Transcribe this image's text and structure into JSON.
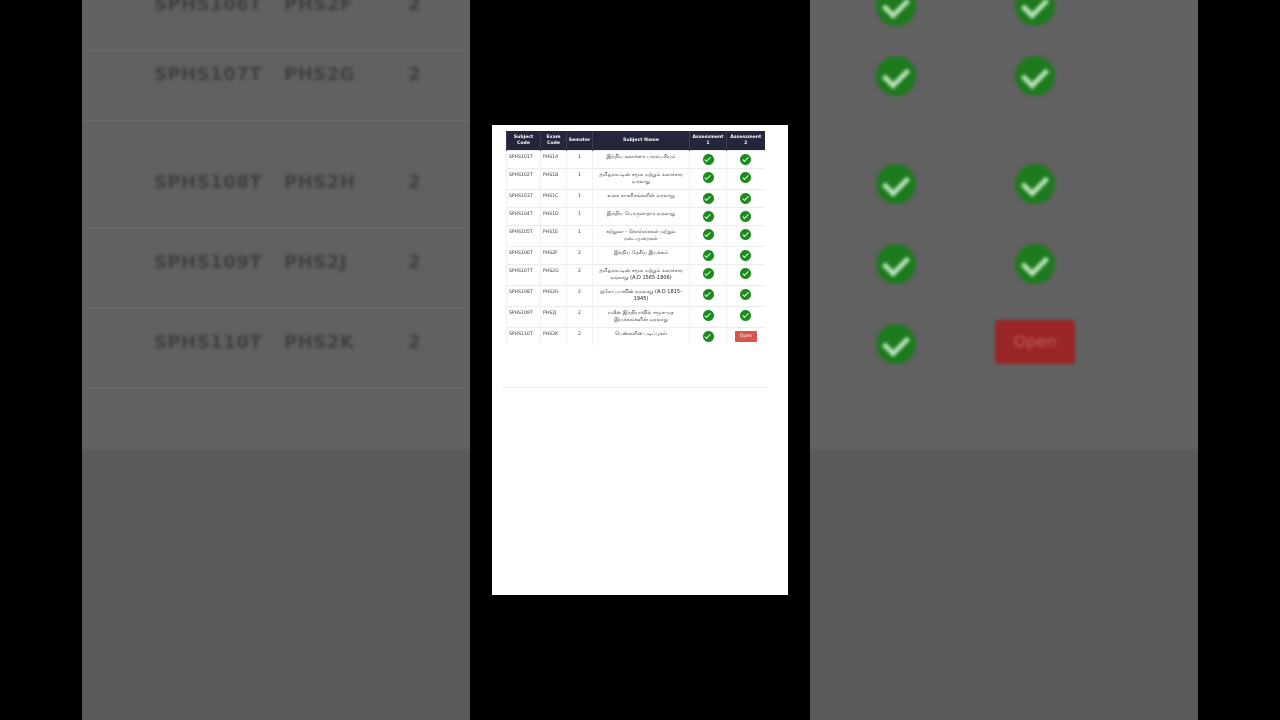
{
  "table": {
    "headers": {
      "subject_code": "Subject Code",
      "exam_code": "Exam Code",
      "semester": "Semster",
      "subject_name": "Subject Name",
      "assessment1": "Assessment 1",
      "assessment2": "Assessment 2"
    },
    "rows": [
      {
        "code": "SPHS101T",
        "exam": "PHS1A",
        "sem": "1",
        "name": "இந்திய கலாச்சார பாரம்பரியம்",
        "a1": "done",
        "a2": "done"
      },
      {
        "code": "SPHS102T",
        "exam": "PHS1B",
        "sem": "1",
        "name": "தமிழ்நாட்டின் சமூக மற்றும் கலாச்சார வரலாறு",
        "a1": "done",
        "a2": "done"
      },
      {
        "code": "SPHS103T",
        "exam": "PHS1C",
        "sem": "1",
        "name": "உலக நாகரிகங்களின் வரலாறு",
        "a1": "done",
        "a2": "done"
      },
      {
        "code": "SPHS104T",
        "exam": "PHS1D",
        "sem": "1",
        "name": "இந்திய பொருளாதார வரலாறு",
        "a1": "done",
        "a2": "done"
      },
      {
        "code": "SPHS105T",
        "exam": "PHS1E",
        "sem": "1",
        "name": "சுற்றுலா - கொள்கைகள் மற்றும் நடைமுறைகள்",
        "a1": "done",
        "a2": "done"
      },
      {
        "code": "SPHS106T",
        "exam": "PHS2F",
        "sem": "2",
        "name": "இந்திய தேசிய இயக்கம்",
        "a1": "done",
        "a2": "done"
      },
      {
        "code": "SPHS107T",
        "exam": "PHS2G",
        "sem": "2",
        "name": "தமிழ்நாட்டின் சமூக மற்றும் கலாச்சார வரலாறு (A.D 1565-1806)",
        "a1": "done",
        "a2": "done"
      },
      {
        "code": "SPHS108T",
        "exam": "PHS2H",
        "sem": "2",
        "name": "ஐரோப்பாவின் வரலாறு (A.D 1815-1945)",
        "a1": "done",
        "a2": "done"
      },
      {
        "code": "SPHS109T",
        "exam": "PHS2J",
        "sem": "2",
        "name": "நவீன இந்தியாவில் சமூக-மத இயக்கங்களின் வரலாறு",
        "a1": "done",
        "a2": "done"
      },
      {
        "code": "SPHS110T",
        "exam": "PHS2K",
        "sem": "2",
        "name": "பெண்களின் படிப்புகள்",
        "a1": "done",
        "a2": "open"
      }
    ],
    "open_label": "Open"
  },
  "background": {
    "rows": [
      {
        "code": "SPHS106T",
        "exam": "PHS2F",
        "sem": "2"
      },
      {
        "code": "SPHS107T",
        "exam": "PHS2G",
        "sem": "2"
      },
      {
        "code": "SPHS108T",
        "exam": "PHS2H",
        "sem": "2"
      },
      {
        "code": "SPHS109T",
        "exam": "PHS2J",
        "sem": "2"
      },
      {
        "code": "SPHS110T",
        "exam": "PHS2K",
        "sem": "2"
      }
    ],
    "open_label": "Open"
  },
  "colors": {
    "header_bg": "#24273b",
    "check_green": "#1a8c1a",
    "open_red": "#d9534f"
  }
}
